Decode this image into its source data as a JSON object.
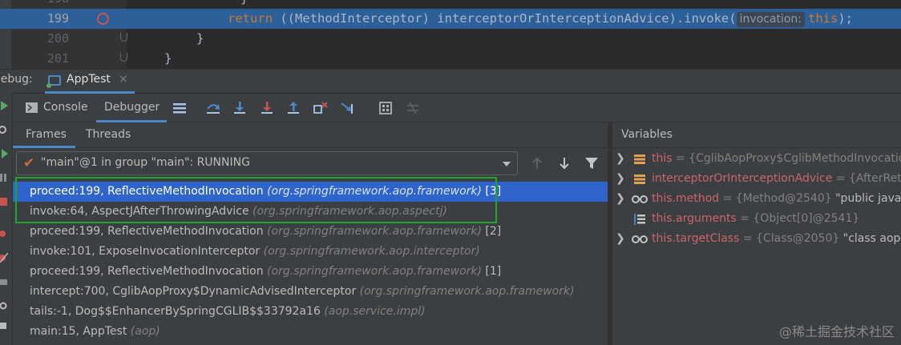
{
  "editor": {
    "lines": [
      {
        "num": "198",
        "text": "}"
      },
      {
        "num": "199",
        "kw": "return",
        "text": " ((MethodInterceptor) interceptorOrInterceptionAdvice).invoke(",
        "hint": "invocation:",
        "arg": "this",
        "end": ");"
      },
      {
        "num": "200",
        "text": "}"
      },
      {
        "num": "201",
        "text": "}"
      }
    ]
  },
  "debug": {
    "label": "Debug:",
    "tab_title": "AppTest",
    "close_glyph": "×"
  },
  "toolbar": {
    "console_label": "Console",
    "debugger_label": "Debugger"
  },
  "frames_panel": {
    "tabs": [
      "Frames",
      "Threads"
    ],
    "thread_status": "\"main\"@1 in group \"main\": RUNNING",
    "frames": [
      {
        "method": "proceed:199, ReflectiveMethodInvocation ",
        "pkg": "(org.springframework.aop.framework)",
        "num": " [3]",
        "selected": true
      },
      {
        "method": "invoke:64, AspectJAfterThrowingAdvice ",
        "pkg": "(org.springframework.aop.aspectj)",
        "num": ""
      },
      {
        "method": "proceed:199, ReflectiveMethodInvocation ",
        "pkg": "(org.springframework.aop.framework)",
        "num": " [2]"
      },
      {
        "method": "invoke:101, ExposeInvocationInterceptor ",
        "pkg": "(org.springframework.aop.interceptor)",
        "num": ""
      },
      {
        "method": "proceed:199, ReflectiveMethodInvocation ",
        "pkg": "(org.springframework.aop.framework)",
        "num": " [1]"
      },
      {
        "method": "intercept:700, CglibAopProxy$DynamicAdvisedInterceptor ",
        "pkg": "(org.springframework.aop.framework)",
        "num": ""
      },
      {
        "method": "tails:-1, Dog$$EnhancerBySpringCGLIB$$33792a16 ",
        "pkg": "(aop.service.impl)",
        "num": ""
      },
      {
        "method": "main:15, AppTest ",
        "pkg": "(aop)",
        "num": ""
      }
    ]
  },
  "variables": {
    "title": "Variables",
    "items": [
      {
        "name": "this",
        "value": " = {CglibAopProxy$CglibMethodInvocation@",
        "str": "",
        "expandable": true,
        "icon": "field-icon"
      },
      {
        "name": "interceptorOrInterceptionAdvice",
        "value": " = {AfterReturn",
        "str": "",
        "expandable": true,
        "icon": "field-icon"
      },
      {
        "name": "this.method",
        "value": " = {Method@2540} ",
        "str": "\"public java.lan",
        "expandable": true,
        "icon": "watch-icon"
      },
      {
        "name": "this.arguments",
        "value": " = {Object[0]@2541}",
        "str": "",
        "expandable": false,
        "icon": "array-icon"
      },
      {
        "name": "this.targetClass",
        "value": " = {Class@2050} ",
        "str": "\"class aop.servi",
        "expandable": true,
        "icon": "watch-icon"
      }
    ]
  },
  "watermark": "@稀土掘金技术社区",
  "colors": {
    "accent": "#4a88c7",
    "selection": "#2f65ca",
    "highlight_box": "#1fa52b",
    "breakpoint": "#c75450"
  }
}
